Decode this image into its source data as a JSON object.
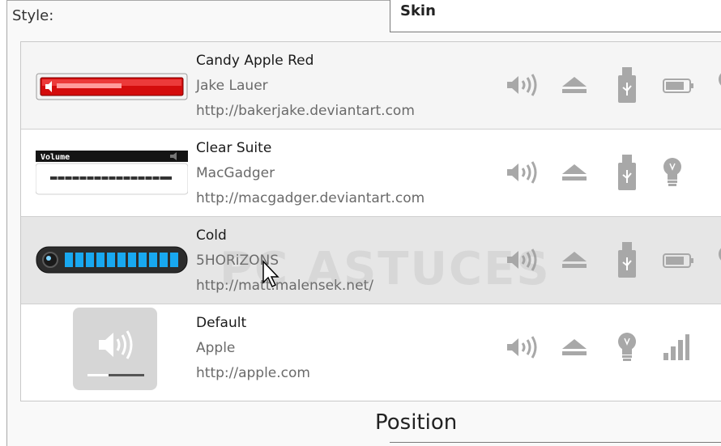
{
  "style_label": "Style:",
  "skin_label": "Skin",
  "position_label": "Position",
  "watermark": "PC ASTUCES",
  "clear_thumb_text": "Volume",
  "skins": [
    {
      "name": "Candy Apple Red",
      "author": "Jake Lauer",
      "url": "http://bakerjake.deviantart.com",
      "icons": [
        "speaker-icon",
        "eject-icon",
        "usb-drive-icon",
        "battery-icon",
        "lightbulb-icon"
      ]
    },
    {
      "name": "Clear Suite",
      "author": "MacGadger",
      "url": "http://macgadger.deviantart.com",
      "icons": [
        "speaker-icon",
        "eject-icon",
        "usb-drive-icon",
        "lightbulb-icon"
      ]
    },
    {
      "name": "Cold",
      "author": "5HORiZONS",
      "url": "http://matt.malensek.net/",
      "icons": [
        "speaker-icon",
        "eject-icon",
        "usb-drive-icon",
        "battery-icon",
        "lightbulb-icon"
      ]
    },
    {
      "name": "Default",
      "author": "Apple",
      "url": "http://apple.com",
      "icons": [
        "speaker-icon",
        "eject-icon",
        "lightbulb-icon",
        "signal-bars-icon"
      ]
    }
  ],
  "colors": {
    "candy_red": "#e01010",
    "cold_blue": "#18a8f0",
    "icon_gray": "#a8a8a8",
    "selected_row": "#e6e6e6"
  }
}
